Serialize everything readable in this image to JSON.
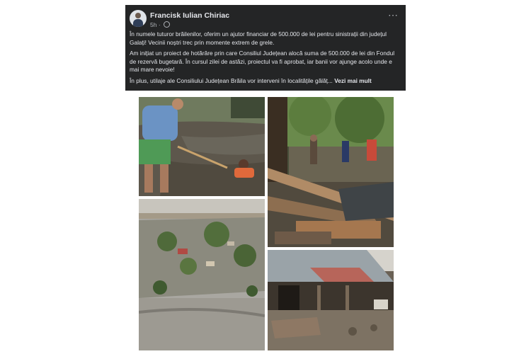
{
  "post": {
    "author": "Francisk Iulian Chiriac",
    "time": "5h",
    "paragraphs": [
      "În numele tuturor brăilenilor, oferim un ajutor financiar de 500.000 de lei pentru sinistrații din județul Galați! Vecinii noștri trec prin momente extrem de grele.",
      "Am inițiat un proiect de hotărâre prin care Consiliul Județean alocă suma de 500.000 de lei din Fondul de rezervă bugetară. În cursul zilei de astăzi, proiectul va fi aprobat, iar banii vor ajunge acolo unde e mai mare nevoie!"
    ],
    "last_paragraph": "În plus, utilaje ale Consiliului Județean Brăila vor interveni în localitățile gălăț...",
    "see_more": "Vezi mai mult",
    "more_icon": "⋯"
  },
  "colors": {
    "post_bg": "#242526",
    "text": "#e4e6eb",
    "secondary_text": "#b0b3b8"
  },
  "icons": [
    "avatar",
    "globe-icon",
    "more-options-icon"
  ]
}
